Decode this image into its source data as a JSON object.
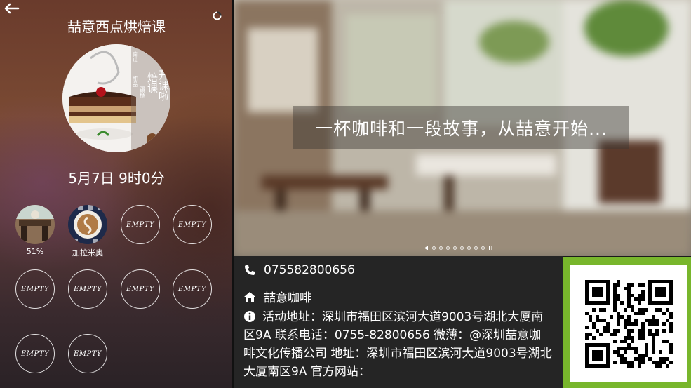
{
  "sidebar": {
    "title": "喆意西点烘焙课",
    "poster_text": [
      "焙课",
      "开课啦"
    ],
    "poster_small_text": [
      "南瓜",
      "甜品",
      "蛋糕"
    ],
    "date": "5月7日 9时0分",
    "slots": [
      {
        "label": "51%",
        "state": "filled",
        "image": "cafe-scene"
      },
      {
        "label": "加拉米奥",
        "state": "filled",
        "image": "latte-art"
      },
      {
        "label": "EMPTY",
        "state": "empty"
      },
      {
        "label": "EMPTY",
        "state": "empty"
      },
      {
        "label": "EMPTY",
        "state": "empty"
      },
      {
        "label": "EMPTY",
        "state": "empty"
      },
      {
        "label": "EMPTY",
        "state": "empty"
      },
      {
        "label": "EMPTY",
        "state": "empty"
      },
      {
        "label": "EMPTY",
        "state": "empty"
      },
      {
        "label": "EMPTY",
        "state": "empty"
      }
    ],
    "icons": {
      "back": "back-arrow-icon",
      "loading": "loading-icon"
    }
  },
  "hero": {
    "banner_text": "一杯咖啡和一段故事，从喆意开始...",
    "carousel": {
      "total_dots": 8,
      "active_index": 0
    }
  },
  "info": {
    "phone": "075582800656",
    "shop_name": "喆意咖啡",
    "description": "活动地址：深圳市福田区滨河大道9003号湖北大厦南区9A 联系电话：0755-82800656 微薄：@深圳喆意咖啡文化传播公司 地址：深圳市福田区滨河大道9003号湖北大厦南区9A 官方网站：",
    "icons": {
      "phone": "phone-icon",
      "home": "home-icon",
      "info": "info-icon"
    }
  },
  "qr": {
    "frame_color": "#78b62c",
    "icon": "qr-code-icon"
  }
}
